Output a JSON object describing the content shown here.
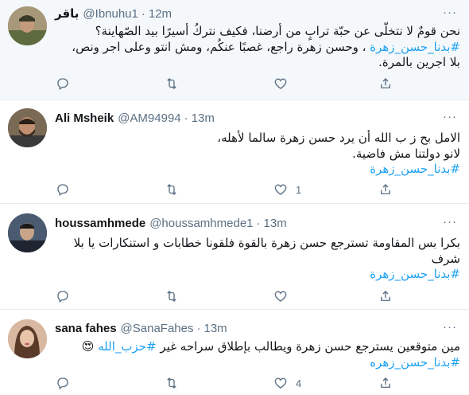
{
  "tweets": [
    {
      "name": "باقر",
      "handle": "@Ibnuhu1",
      "dot": "·",
      "time": "12m",
      "lines": [
        "نحن قومٌ لا نتخلّى عن حبّة ترابٍ من أرضنا، فكيف نتركُ أسيرًا بيد الصّهاينة؟",
        "#بدنا_حسن_زهرة ، وحسن زهرة راجع، غصبًا عنكُم، ومش انتو وعلى اجر ونص،",
        "بلا اجرين بالمرة."
      ],
      "hashtag_line": 1,
      "replies": "",
      "retweets": "",
      "likes": "",
      "avatar_color": "#8b7a5a",
      "avatar_icon": "military-portrait-icon"
    },
    {
      "name": "Ali Msheik",
      "handle": "@AM94994",
      "dot": "·",
      "time": "13m",
      "lines": [
        "الامل بح ز ب الله أن يرد حسن زهرة سالما لأهله،",
        "لانو دولتنا مش فاضية.",
        "#بدنا_حسن_زهرة"
      ],
      "hashtag_line": 2,
      "replies": "",
      "retweets": "",
      "likes": "1",
      "avatar_color": "#6b5a48",
      "avatar_icon": "bearded-man-icon"
    },
    {
      "name": "houssamhmede",
      "handle": "@houssamhmede1",
      "dot": "·",
      "time": "13m",
      "lines": [
        "بكرا بس المقاومة تسترجع حسن زهرة بالقوة فلقونا خطابات و استنكارات يا بلا",
        "شرف",
        "#بدنا_حسن_زهرة"
      ],
      "hashtag_line": 2,
      "replies": "",
      "retweets": "",
      "likes": "",
      "avatar_color": "#3e4a5c",
      "avatar_icon": "man-portrait-icon"
    },
    {
      "name": "sana fahes",
      "handle": "@SanaFahes",
      "dot": "·",
      "time": "13m",
      "lines": [
        "مين متوقعين يسترجع حسن زهرة ويطالب بإطلاق سراحه غير #حزب_الله 😍",
        "#بدنا_حسن_زهره"
      ],
      "hashtag_line": 1,
      "inline_hashtag": "#حزب_الله",
      "replies": "",
      "retweets": "",
      "likes": "4",
      "avatar_color": "#c9a08a",
      "avatar_icon": "woman-portrait-icon"
    }
  ],
  "icons": {
    "reply": "reply-icon",
    "retweet": "retweet-icon",
    "like": "heart-icon",
    "share": "share-icon",
    "more": "more-options-icon"
  },
  "colors": {
    "accent": "#1da1f2",
    "muted": "#5b7083",
    "border": "#e6ecf0",
    "highlight_bg": "#f5f8fa"
  }
}
